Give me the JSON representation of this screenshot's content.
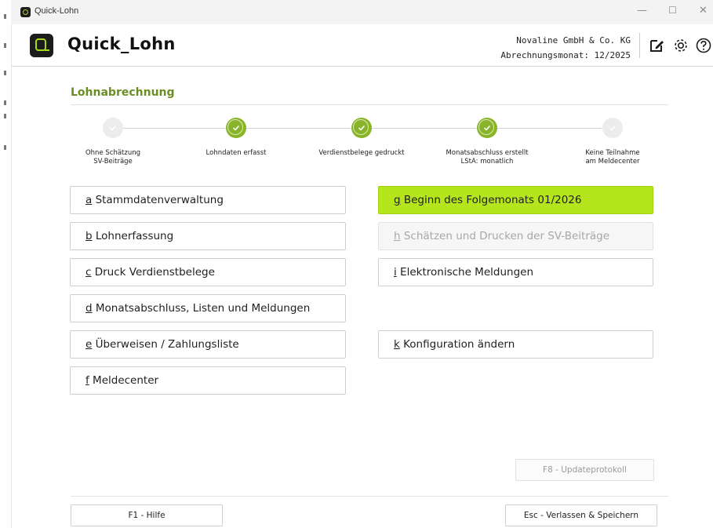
{
  "window": {
    "title": "Quick-Lohn",
    "controls": {
      "minimize": "—",
      "maximize": "☐",
      "close": "✕"
    }
  },
  "header": {
    "app_name": "Quick_Lohn",
    "company": "Novaline GmbH & Co. KG",
    "period": "Abrechnungsmonat: 12/2025",
    "icons": [
      "edit-icon",
      "gear-icon",
      "help-icon"
    ]
  },
  "section_title": "Lohnabrechnung",
  "steps": [
    {
      "label": "Ohne Schätzung\nSV-Beiträge",
      "done": false
    },
    {
      "label": "Lohndaten erfasst",
      "done": true
    },
    {
      "label": "Verdienstbelege gedruckt",
      "done": true
    },
    {
      "label": "Monatsabschluss erstellt\nLStA: monatlich",
      "done": true
    },
    {
      "label": "Keine Teilnahme\nam Meldecenter",
      "done": false
    }
  ],
  "left_buttons": [
    {
      "key": "a",
      "label": " Stammdatenverwaltung"
    },
    {
      "key": "b",
      "label": " Lohnerfassung"
    },
    {
      "key": "c",
      "label": " Druck Verdienstbelege"
    },
    {
      "key": "d",
      "label": " Monatsabschluss, Listen und Meldungen"
    },
    {
      "key": "e",
      "label": " Überweisen / Zahlungsliste"
    },
    {
      "key": "f",
      "label": " Meldecenter"
    }
  ],
  "right_buttons": [
    {
      "key": "g",
      "label": " Beginn des Folgemonats 01/2026",
      "state": "primary"
    },
    {
      "key": "h",
      "label": " Schätzen und Drucken der SV-Beiträge",
      "state": "disabled"
    },
    {
      "key": "i",
      "label": " Elektronische Meldungen",
      "state": "normal"
    },
    {
      "key": "k",
      "label": " Konfiguration ändern",
      "state": "normal"
    }
  ],
  "update_button": "F8 - Updateprotokoll",
  "footer": {
    "help": "F1 - Hilfe",
    "exit": "Esc - Verlassen & Speichern"
  },
  "colors": {
    "accent": "#b5e61d",
    "step_done": "#89b42a",
    "title_green": "#6b8e23"
  }
}
